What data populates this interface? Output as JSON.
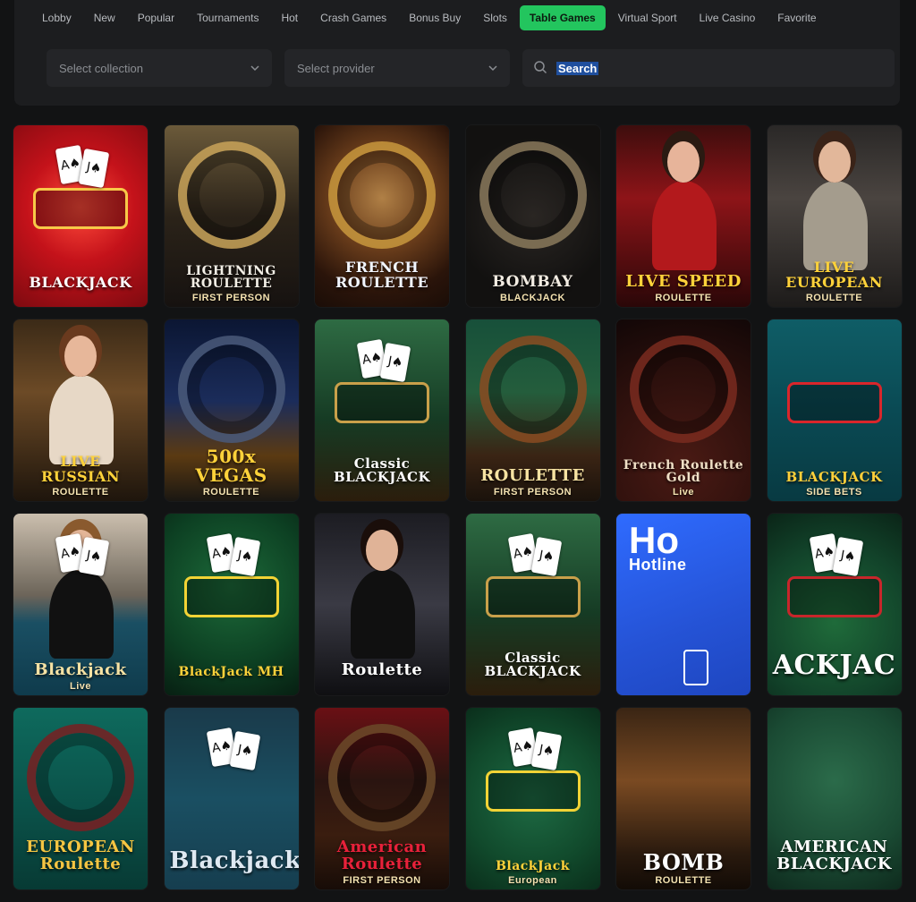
{
  "nav": {
    "tabs": [
      {
        "label": "Lobby"
      },
      {
        "label": "New"
      },
      {
        "label": "Popular"
      },
      {
        "label": "Tournaments"
      },
      {
        "label": "Hot"
      },
      {
        "label": "Crash Games"
      },
      {
        "label": "Bonus Buy"
      },
      {
        "label": "Slots"
      },
      {
        "label": "Table Games",
        "active": true
      },
      {
        "label": "Virtual Sport"
      },
      {
        "label": "Live Casino"
      },
      {
        "label": "Favorite"
      }
    ]
  },
  "filters": {
    "collection_placeholder": "Select collection",
    "provider_placeholder": "Select provider",
    "search_value": "Search"
  },
  "colors": {
    "accent": "#23c55e",
    "background": "#121314",
    "panel": "#1c1d1f",
    "input": "#242528"
  },
  "games": [
    {
      "title": "BLACKJACK",
      "subtitle": "",
      "theme": "red-blackjack"
    },
    {
      "title": "LIGHTNING ROULETTE",
      "subtitle": "FIRST PERSON",
      "theme": "lightning"
    },
    {
      "title": "FRENCH ROULETTE",
      "subtitle": "",
      "theme": "french"
    },
    {
      "title": "BOMBAY",
      "subtitle": "BLACKJACK",
      "theme": "bombay"
    },
    {
      "title": "LIVE SPEED",
      "subtitle": "ROULETTE",
      "theme": "speed"
    },
    {
      "title": "LIVE EUROPEAN",
      "subtitle": "ROULETTE",
      "theme": "european-live"
    },
    {
      "title": "LIVE RUSSIAN",
      "subtitle": "ROULETTE",
      "theme": "russian"
    },
    {
      "title": "500x VEGAS",
      "subtitle": "ROULETTE",
      "theme": "vegas"
    },
    {
      "title": "Classic BLACKJACK",
      "subtitle": "",
      "theme": "classic"
    },
    {
      "title": "ROULETTE",
      "subtitle": "FIRST PERSON",
      "theme": "roulette-fp"
    },
    {
      "title": "French Roulette Gold",
      "subtitle": "Live",
      "theme": "french-gold"
    },
    {
      "title": "BLACKJACK",
      "subtitle": "SIDE BETS",
      "theme": "sidebets"
    },
    {
      "title": "Blackjack",
      "subtitle": "Live",
      "theme": "bj-live"
    },
    {
      "title": "BlackJack MH",
      "subtitle": "",
      "theme": "bj-mh"
    },
    {
      "title": "Roulette",
      "subtitle": "",
      "theme": "roulette-dealer"
    },
    {
      "title": "Classic BLACKJACK",
      "subtitle": "",
      "theme": "classic"
    },
    {
      "title": "Hotline",
      "subtitle": "Ho",
      "theme": "hotline"
    },
    {
      "title": "ACKJAC",
      "subtitle": "",
      "theme": "ackjac"
    },
    {
      "title": "EUROPEAN Roulette",
      "subtitle": "",
      "theme": "european"
    },
    {
      "title": "Blackjack",
      "subtitle": "",
      "theme": "bj-blue"
    },
    {
      "title": "American Roulette",
      "subtitle": "FIRST PERSON",
      "theme": "american"
    },
    {
      "title": "BlackJack",
      "subtitle": "European",
      "theme": "bj-european"
    },
    {
      "title": "BOMB",
      "subtitle": "ROULETTE",
      "theme": "bomb"
    },
    {
      "title": "AMERICAN BLACKJACK",
      "subtitle": "",
      "theme": "american-bj"
    }
  ]
}
